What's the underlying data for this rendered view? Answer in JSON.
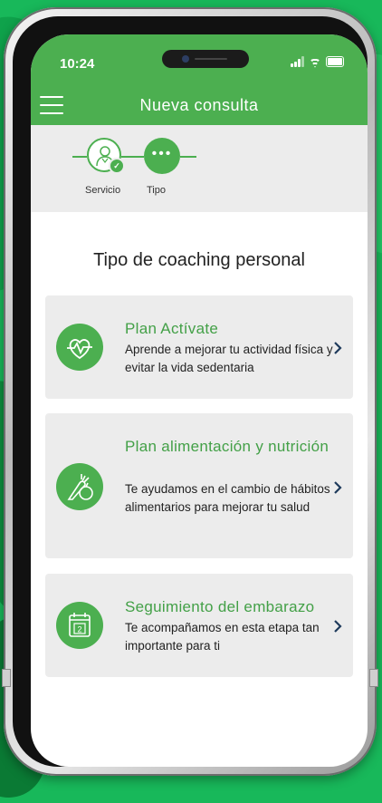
{
  "status_bar": {
    "time": "10:24"
  },
  "header": {
    "title": "Nueva consulta"
  },
  "stepper": {
    "steps": [
      {
        "label": "Servicio"
      },
      {
        "label": "Tipo"
      }
    ]
  },
  "main": {
    "title": "Tipo de coaching personal",
    "options": [
      {
        "title": "Plan Actívate",
        "description": "Aprende a mejorar tu actividad física y evitar la vida sedentaria",
        "icon": "heart-pulse-icon"
      },
      {
        "title": "Plan alimentación y nutrición",
        "description": "Te ayudamos en el cambio de hábitos alimentarios para mejorar tu salud",
        "icon": "carrot-apple-icon"
      },
      {
        "title": "Seguimiento del embarazo",
        "description": "Te acompañamos en esta etapa tan importante para ti",
        "icon": "calendar-icon"
      }
    ]
  },
  "colors": {
    "accent": "#4caf50",
    "background": "#18b85a",
    "card": "#ececec"
  }
}
